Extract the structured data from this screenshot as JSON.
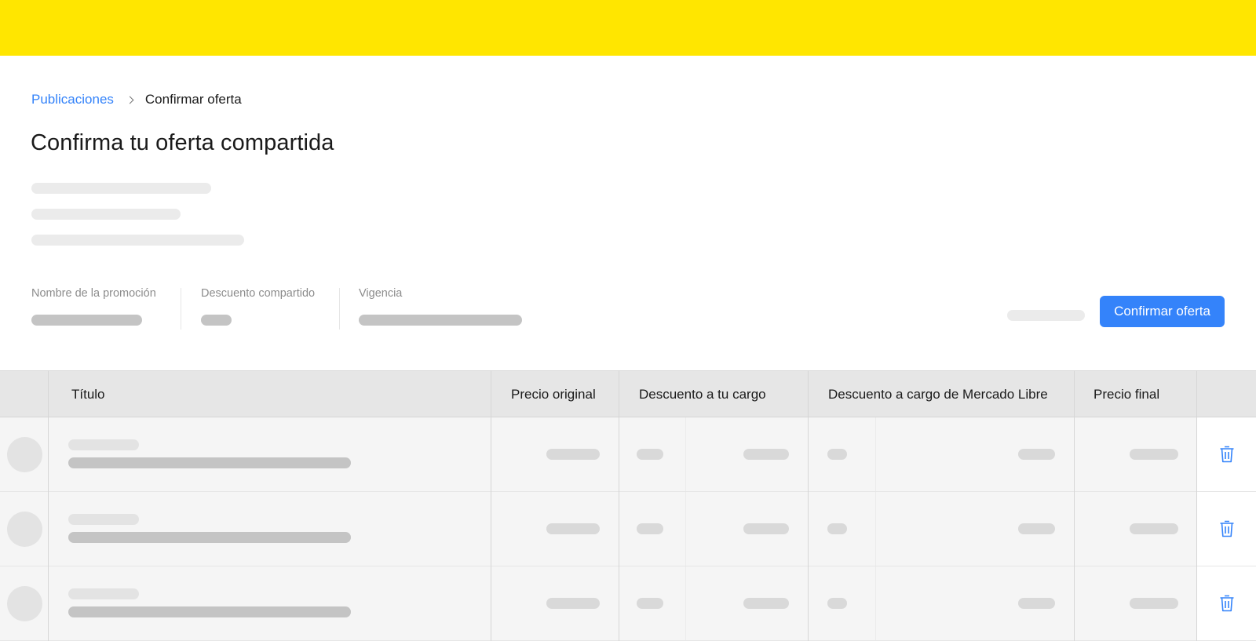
{
  "header": {
    "brand_color": "#ffe600"
  },
  "breadcrumb": {
    "link_label": "Publicaciones",
    "current_label": "Confirmar oferta"
  },
  "page": {
    "title": "Confirma tu oferta compartida"
  },
  "summary": {
    "promotion_name_label": "Nombre de la promoción",
    "shared_discount_label": "Descuento compartido",
    "validity_label": "Vigencia"
  },
  "actions": {
    "confirm_label": "Confirmar oferta",
    "accent_color": "#3483fa"
  },
  "table": {
    "columns": [
      "Título",
      "Precio original",
      "Descuento a tu cargo",
      "Descuento a cargo de Mercado Libre",
      "Precio final"
    ],
    "row_icons": [
      "trash-icon",
      "trash-icon",
      "trash-icon"
    ]
  }
}
